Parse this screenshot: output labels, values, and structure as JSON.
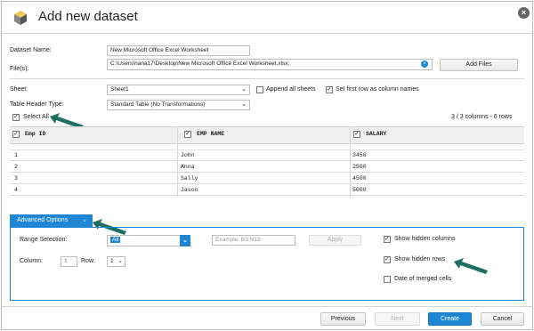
{
  "dialog": {
    "title": "Add new dataset"
  },
  "form": {
    "dataset_name_label": "Dataset Name:",
    "dataset_name_value": "New Microsoft Office Excel Worksheet",
    "files_label": "File(s):",
    "files_value": "C:\\Users\\hana17\\Desktop\\New Microsoft Office Excel Worksheet.xlsx;",
    "add_files_label": "Add Files",
    "sheet_label": "Sheet:",
    "sheet_value": "Sheet1",
    "append_all_sheets_label": "Append all sheets",
    "append_all_sheets_checked": false,
    "first_row_label": "Set first row as column names",
    "first_row_checked": true,
    "table_header_type_label": "Table Header Type:",
    "table_header_type_value": "Standard Table (No Transformations)",
    "select_all_label": "Select All",
    "select_all_checked": true,
    "columns_summary": "3 / 3 columns - 6 rows"
  },
  "grid": {
    "columns": [
      "Emp ID",
      "EMP NAME",
      "SALARY"
    ],
    "rows": [
      [
        "1",
        "John",
        "3456"
      ],
      [
        "2",
        "Anna",
        "2500"
      ],
      [
        "3",
        "Sally",
        "4500"
      ],
      [
        "4",
        "Jason",
        "5000"
      ]
    ]
  },
  "advanced": {
    "tab_label": "Advanced Options",
    "range_selection_label": "Range Selection:",
    "range_selection_value": "All",
    "example_placeholder": "Example:    B3:N18",
    "apply_label": "Apply",
    "column_label": "Column:",
    "column_value": "1",
    "row_label": "Row:",
    "row_value": "1",
    "show_hidden_columns_label": "Show hidden columns",
    "show_hidden_columns_checked": true,
    "show_hidden_rows_label": "Show hidden rows",
    "show_hidden_rows_checked": true,
    "date_merged_cells_label": "Date of merged cells",
    "date_merged_cells_checked": false
  },
  "footer": {
    "previous_label": "Previous",
    "next_label": "Next",
    "create_label": "Create",
    "cancel_label": "Cancel"
  },
  "colors": {
    "accent": "#1d87d6",
    "annotation_arrow": "#1e6e63"
  },
  "icons": {
    "logo": "cube-logo-icon",
    "close": "close-icon",
    "clear": "clear-x-icon",
    "dropdown": "chevron-down-icon",
    "checkbox": "checkbox-icon",
    "annotation": "arrow-annotation-icon"
  }
}
